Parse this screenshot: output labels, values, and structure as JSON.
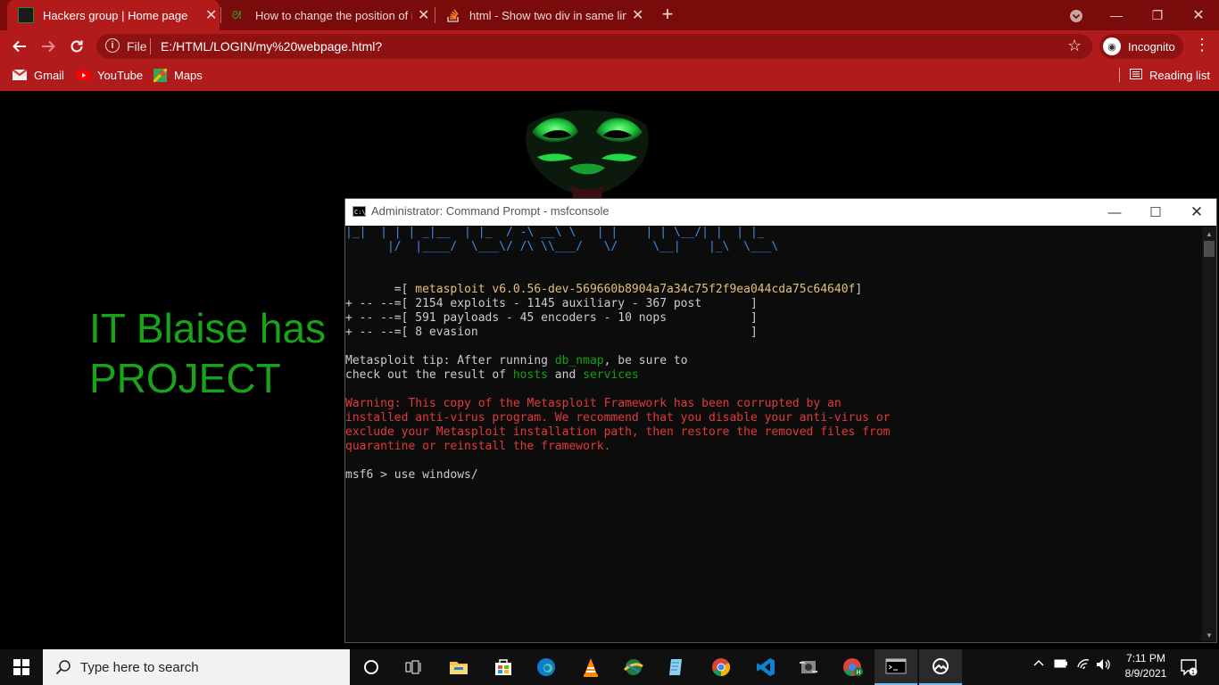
{
  "browser": {
    "tabs": [
      {
        "label": "Hackers group | Home page",
        "active": true
      },
      {
        "label": "How to change the position of m",
        "active": false
      },
      {
        "label": "html - Show two div in same line",
        "active": false
      }
    ],
    "new_tab": "+",
    "address": {
      "scheme_label": "File",
      "url": "E:/HTML/LOGIN/my%20webpage.html?"
    },
    "profile_label": "Incognito",
    "bookmarks": [
      {
        "label": "Gmail",
        "icon": "gmail-icon"
      },
      {
        "label": "YouTube",
        "icon": "youtube-icon"
      },
      {
        "label": "Maps",
        "icon": "maps-icon"
      }
    ],
    "reading_list": "Reading list",
    "colors": {
      "frame": "#7a0b0b",
      "toolbar": "#b21b1b",
      "omnibox": "#8f1212"
    }
  },
  "page": {
    "headline_line1": "IT Blaise has",
    "headline_line2": "PROJECT",
    "headline_color": "#19a31a"
  },
  "cmd": {
    "title": "Administrator: Command Prompt - msfconsole",
    "banner": [
      "|_|  | | | _|__  | |_  / -\\ __\\ \\   | |    | | \\__/| |  | |_",
      "      |/  |____/  \\___\\/ /\\ \\\\___/   \\/     \\__|    |_\\  \\___\\"
    ],
    "version_prefix": "       =[ ",
    "version": "metasploit v6.0.56-dev-569660b8904a7a34c75f2f9ea044cda75c64640f",
    "version_suffix": "]",
    "stats": [
      "+ -- --=[ 2154 exploits - 1145 auxiliary - 367 post       ]",
      "+ -- --=[ 591 payloads - 45 encoders - 10 nops            ]",
      "+ -- --=[ 8 evasion                                       ]"
    ],
    "tip": {
      "a": "Metasploit tip: After running ",
      "b": "db_nmap",
      "c": ", be sure to",
      "d": "check out the result of ",
      "e": "hosts",
      "f": " and ",
      "g": "services"
    },
    "warning": [
      "Warning: This copy of the Metasploit Framework has been corrupted by an",
      "installed anti-virus program. We recommend that you disable your anti-virus or",
      "exclude your Metasploit installation path, then restore the removed files from",
      "quarantine or reinstall the framework."
    ],
    "prompt": "msf6 > use windows/"
  },
  "taskbar": {
    "search_placeholder": "Type here to search",
    "time": "7:11 PM",
    "date": "8/9/2021",
    "apps": [
      "cortana-icon",
      "task-view-icon",
      "file-explorer-icon",
      "store-icon",
      "edge-icon",
      "vlc-icon",
      "idm-icon",
      "notepad-icon",
      "chrome-icon",
      "vscode-icon",
      "tool-icon",
      "chrome-profile-icon",
      "cmd-icon",
      "photos-icon"
    ]
  }
}
